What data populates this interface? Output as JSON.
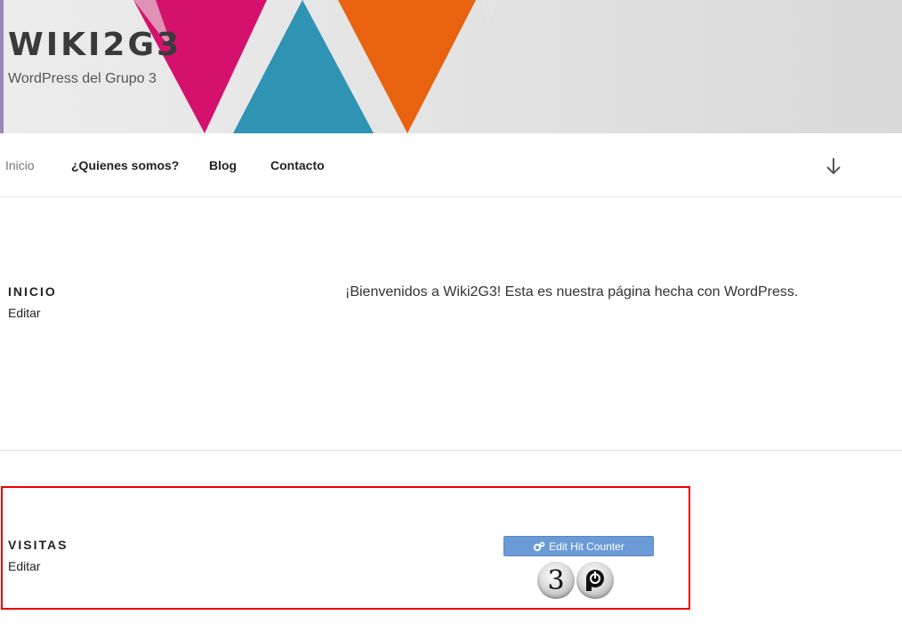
{
  "site": {
    "title": "WIKI2G3",
    "description": "WordPress del Grupo 3"
  },
  "nav": {
    "items": [
      {
        "label": "Inicio",
        "current": true
      },
      {
        "label": "¿Quienes somos?",
        "current": false
      },
      {
        "label": "Blog",
        "current": false
      },
      {
        "label": "Contacto",
        "current": false
      }
    ],
    "scroll_icon": "arrow-down-icon"
  },
  "sections": {
    "inicio": {
      "title": "INICIO",
      "edit": "Editar",
      "content": "¡Bienvenidos a Wiki2G3! Esta es nuestra página hecha con WordPress."
    },
    "visitas": {
      "title": "VISITAS",
      "edit": "Editar",
      "counter_button": "Edit Hit Counter",
      "counter_digit": "3"
    }
  },
  "colors": {
    "highlight_border": "#e00000",
    "button_bg": "#6b9bd6",
    "header_pink": "#d4116c",
    "header_blue": "#2f93b4",
    "header_orange": "#e8620f"
  }
}
